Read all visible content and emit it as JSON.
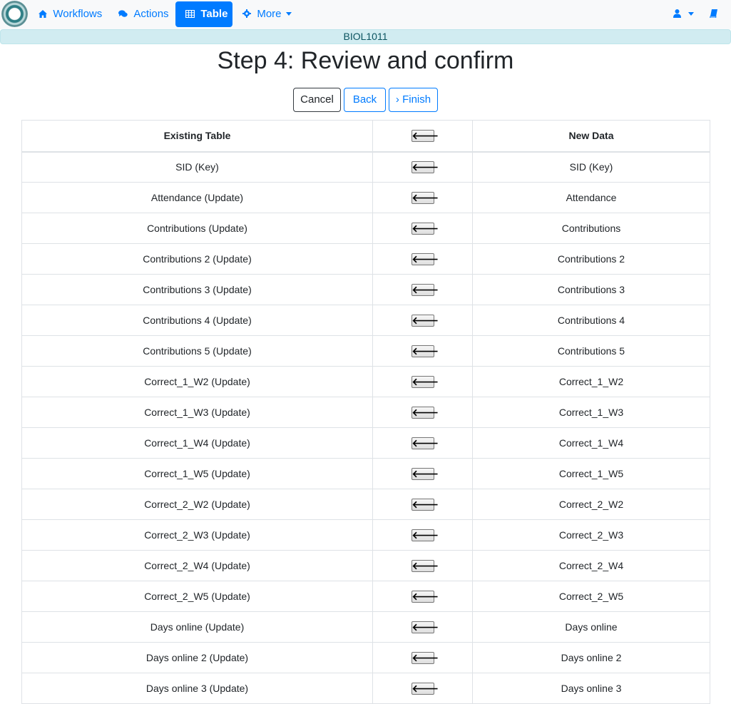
{
  "navbar": {
    "workflows_label": "Workflows",
    "actions_label": "Actions",
    "table_label": "Table",
    "more_label": "More"
  },
  "course_banner": "BIOL1011",
  "page_title": "Step 4: Review and confirm",
  "buttons": {
    "cancel": "Cancel",
    "back": "Back",
    "finish": "› Finish"
  },
  "table": {
    "headers": {
      "existing": "Existing Table",
      "arrow": "🡐",
      "new": "New Data"
    },
    "rows": [
      {
        "existing": "SID (Key)",
        "new": "SID (Key)"
      },
      {
        "existing": "Attendance (Update)",
        "new": "Attendance"
      },
      {
        "existing": "Contributions (Update)",
        "new": "Contributions"
      },
      {
        "existing": "Contributions 2 (Update)",
        "new": "Contributions 2"
      },
      {
        "existing": "Contributions 3 (Update)",
        "new": "Contributions 3"
      },
      {
        "existing": "Contributions 4 (Update)",
        "new": "Contributions 4"
      },
      {
        "existing": "Contributions 5 (Update)",
        "new": "Contributions 5"
      },
      {
        "existing": "Correct_1_W2 (Update)",
        "new": "Correct_1_W2"
      },
      {
        "existing": "Correct_1_W3 (Update)",
        "new": "Correct_1_W3"
      },
      {
        "existing": "Correct_1_W4 (Update)",
        "new": "Correct_1_W4"
      },
      {
        "existing": "Correct_1_W5 (Update)",
        "new": "Correct_1_W5"
      },
      {
        "existing": "Correct_2_W2 (Update)",
        "new": "Correct_2_W2"
      },
      {
        "existing": "Correct_2_W3 (Update)",
        "new": "Correct_2_W3"
      },
      {
        "existing": "Correct_2_W4 (Update)",
        "new": "Correct_2_W4"
      },
      {
        "existing": "Correct_2_W5 (Update)",
        "new": "Correct_2_W5"
      },
      {
        "existing": "Days online (Update)",
        "new": "Days online"
      },
      {
        "existing": "Days online 2 (Update)",
        "new": "Days online 2"
      },
      {
        "existing": "Days online 3 (Update)",
        "new": "Days online 3"
      }
    ]
  },
  "icons": {
    "workflows": "home-icon",
    "actions": "comments-icon",
    "table": "table-icon",
    "more": "gear-icon",
    "user": "user-icon",
    "book": "book-icon"
  },
  "colors": {
    "primary": "#007bff",
    "banner_bg": "#d1ecf1",
    "banner_text": "#0c5460"
  }
}
